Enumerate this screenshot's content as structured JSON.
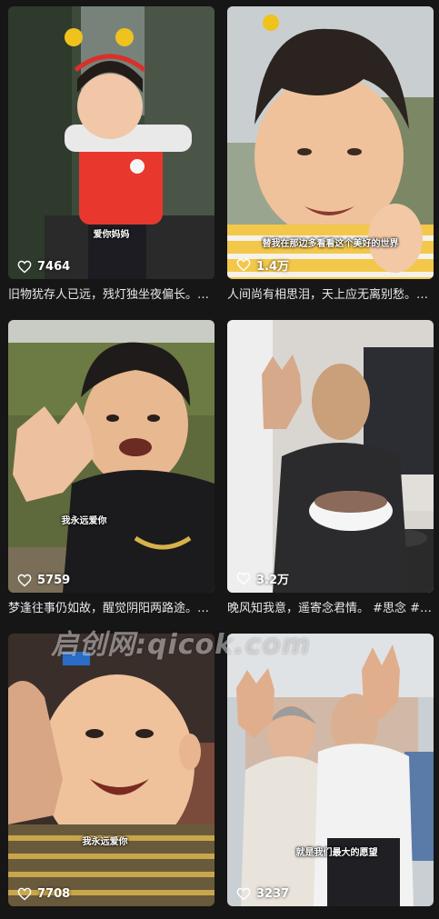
{
  "feed": {
    "items": [
      {
        "likes": "7464",
        "caption": "旧物犹存人已远，残灯独坐夜偏长。…",
        "subtitle": "爱你妈妈"
      },
      {
        "likes": "1.4万",
        "caption": "人间尚有相思泪，天上应无离别愁。…",
        "subtitle": "替我在那边多看看这个美好的世界"
      },
      {
        "likes": "5759",
        "caption": "梦逢往事仍如故，醒觉阴阳两路途。…",
        "subtitle": "我永远爱你"
      },
      {
        "likes": "3.2万",
        "caption": "晚风知我意，遥寄念君情。 #思念 #…",
        "subtitle": ""
      },
      {
        "likes": "7708",
        "caption": "",
        "subtitle": "我永远爱你"
      },
      {
        "likes": "3237",
        "caption": "",
        "subtitle": "就是我们最大的愿望"
      }
    ]
  },
  "watermark": "启创网:qicok.com",
  "icons": {
    "like": "heart-outline-icon"
  },
  "colors": {
    "background": "#161616",
    "text": "#ffffff"
  }
}
